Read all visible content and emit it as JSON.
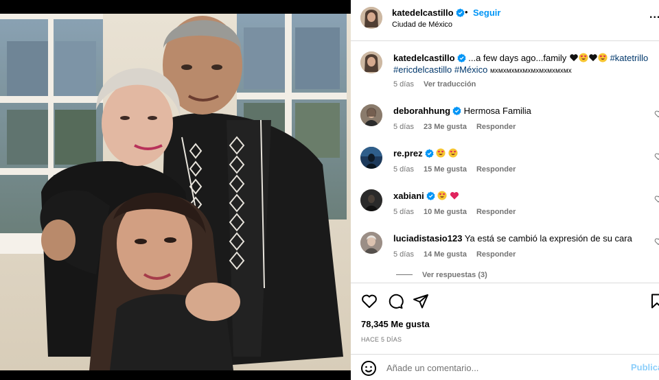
{
  "post": {
    "author": "katedelcastillo",
    "separator": "•",
    "follow_label": "Seguir",
    "location": "Ciudad de México",
    "more_label": "..."
  },
  "caption": {
    "username": "katedelcastillo",
    "text_1": "...a few days ago...family",
    "hashtag_1": "#katetrillo",
    "hashtag_2": "#ericdelcastillo",
    "hashtag_3": "#México",
    "trailing": "мхмхмхмхмхмхмхмхмхмх",
    "time": "5 días",
    "translate_label": "Ver traducción"
  },
  "comments": [
    {
      "username": "deborahhung",
      "verified": true,
      "text": "Hermosa Familia",
      "time": "5 días",
      "likes": "23 Me gusta",
      "reply_label": "Responder",
      "avatar_color": "#8a7b6c"
    },
    {
      "username": "re.prez",
      "verified": true,
      "text": "",
      "time": "5 días",
      "likes": "15 Me gusta",
      "reply_label": "Responder",
      "avatar_color": "#1d3a5c"
    },
    {
      "username": "xabiani",
      "verified": true,
      "text": "",
      "time": "5 días",
      "likes": "10 Me gusta",
      "reply_label": "Responder",
      "avatar_color": "#2a2a2a"
    },
    {
      "username": "luciadistasio123",
      "verified": false,
      "text": "Ya está se cambió la expresión de su cara",
      "time": "5 días",
      "likes": "14 Me gusta",
      "reply_label": "Responder",
      "avatar_color": "#9b8e86"
    }
  ],
  "replies_label": "Ver respuestas (3)",
  "actions": {
    "likes": "78,345 Me gusta",
    "date": "HACE 5 DÍAS"
  },
  "composer": {
    "placeholder": "Añade un comentario...",
    "post_label": "Publica"
  },
  "colors": {
    "accent": "#0095f6",
    "hashtag": "#00376b",
    "muted": "#737373",
    "border": "#dbdbdb",
    "heart_emoji": "#e0245e"
  }
}
